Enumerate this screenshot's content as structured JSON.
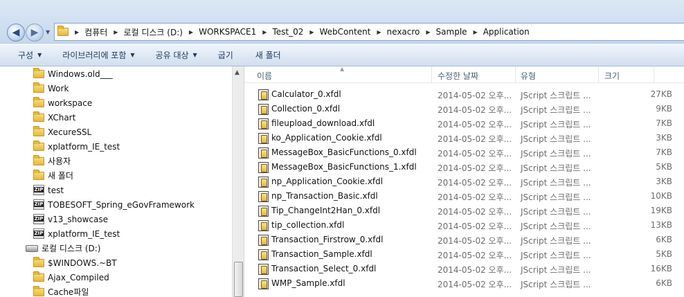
{
  "address": {
    "crumbs": [
      "컴퓨터",
      "로컬 디스크 (D:)",
      "WORKSPACE1",
      "Test_02",
      "WebContent",
      "nexacro",
      "Sample",
      "Application"
    ]
  },
  "toolbar": {
    "organize": "구성",
    "library": "라이브러리에 포함",
    "share": "공유 대상",
    "burn": "굽기",
    "new_folder": "새 폴더"
  },
  "nav": {
    "items": [
      {
        "label": "Windows.old___",
        "icon": "folder-icon"
      },
      {
        "label": "Work",
        "icon": "folder-icon"
      },
      {
        "label": "workspace",
        "icon": "folder-icon"
      },
      {
        "label": "XChart",
        "icon": "folder-icon"
      },
      {
        "label": "XecureSSL",
        "icon": "folder-icon"
      },
      {
        "label": "xplatform_IE_test",
        "icon": "folder-icon"
      },
      {
        "label": "사용자",
        "icon": "folder-icon"
      },
      {
        "label": "새 폴더",
        "icon": "folder-icon"
      },
      {
        "label": "test",
        "icon": "zip-icon"
      },
      {
        "label": "TOBESOFT_Spring_eGovFramework",
        "icon": "zip-icon"
      },
      {
        "label": "v13_showcase",
        "icon": "zip-icon"
      },
      {
        "label": "xplatform_IE_test",
        "icon": "zip-icon"
      },
      {
        "label": "로컬 디스크 (D:)",
        "icon": "drive-icon"
      },
      {
        "label": "$WINDOWS.~BT",
        "icon": "folder-icon"
      },
      {
        "label": "Ajax_Compiled",
        "icon": "folder-icon"
      },
      {
        "label": "Cache파일",
        "icon": "folder-icon"
      }
    ]
  },
  "list": {
    "headers": {
      "name": "이름",
      "date": "수정한 날짜",
      "type": "유형",
      "size": "크기"
    },
    "files": [
      {
        "name": "Calculator_0.xfdl",
        "date": "2014-05-02 오후...",
        "type": "JScript 스크립트 ...",
        "size": "27KB"
      },
      {
        "name": "Collection_0.xfdl",
        "date": "2014-05-02 오후...",
        "type": "JScript 스크립트 ...",
        "size": "9KB"
      },
      {
        "name": "fileupload_download.xfdl",
        "date": "2014-05-02 오후...",
        "type": "JScript 스크립트 ...",
        "size": "7KB"
      },
      {
        "name": "ko_Application_Cookie.xfdl",
        "date": "2014-05-02 오후...",
        "type": "JScript 스크립트 ...",
        "size": "3KB"
      },
      {
        "name": "MessageBox_BasicFunctions_0.xfdl",
        "date": "2014-05-02 오후...",
        "type": "JScript 스크립트 ...",
        "size": "7KB"
      },
      {
        "name": "MessageBox_BasicFunctions_1.xfdl",
        "date": "2014-05-02 오후...",
        "type": "JScript 스크립트 ...",
        "size": "5KB"
      },
      {
        "name": "np_Application_Cookie.xfdl",
        "date": "2014-05-02 오후...",
        "type": "JScript 스크립트 ...",
        "size": "3KB"
      },
      {
        "name": "np_Transaction_Basic.xfdl",
        "date": "2014-05-02 오후...",
        "type": "JScript 스크립트 ...",
        "size": "10KB"
      },
      {
        "name": "Tip_ChangeInt2Han_0.xfdl",
        "date": "2014-05-02 오후...",
        "type": "JScript 스크립트 ...",
        "size": "19KB"
      },
      {
        "name": "tip_collection.xfdl",
        "date": "2014-05-02 오후...",
        "type": "JScript 스크립트 ...",
        "size": "13KB"
      },
      {
        "name": "Transaction_Firstrow_0.xfdl",
        "date": "2014-05-02 오후...",
        "type": "JScript 스크립트 ...",
        "size": "6KB"
      },
      {
        "name": "Transaction_Sample.xfdl",
        "date": "2014-05-02 오후...",
        "type": "JScript 스크립트 ...",
        "size": "5KB"
      },
      {
        "name": "Transaction_Select_0.xfdl",
        "date": "2014-05-02 오후...",
        "type": "JScript 스크립트 ...",
        "size": "16KB"
      },
      {
        "name": "WMP_Sample.xfdl",
        "date": "2014-05-02 오후...",
        "type": "JScript 스크립트 ...",
        "size": "6KB"
      }
    ]
  }
}
